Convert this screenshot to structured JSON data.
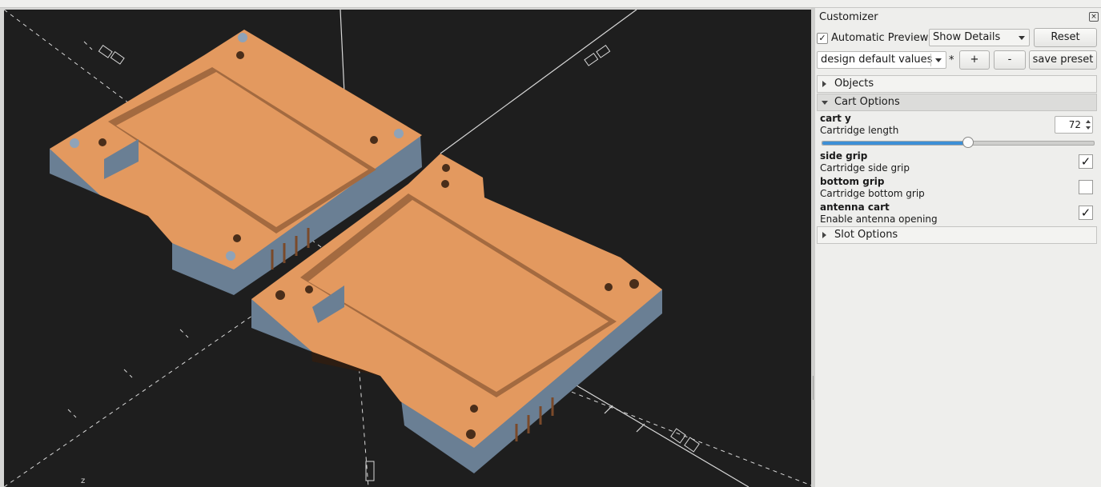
{
  "viewport": {
    "axis_label": "z",
    "colors": {
      "background": "#1e1e1e",
      "part_top": "#e3995f",
      "part_side": "#6a7f94",
      "pocket": "#a36a40",
      "pin": "#8fa3b8"
    }
  },
  "customizer": {
    "title": "Customizer",
    "close_icon": "close-icon",
    "auto_preview_label": "Automatic Preview",
    "auto_preview_checked": true,
    "details_select": "Show Details",
    "reset_label": "Reset",
    "preset_select": "design default values",
    "modified_marker": "*",
    "add_label": "+",
    "remove_label": "-",
    "save_label": "save preset",
    "groups": [
      {
        "label": "Objects",
        "expanded": false
      },
      {
        "label": "Cart Options",
        "expanded": true
      },
      {
        "label": "Slot Options",
        "expanded": false
      }
    ],
    "params": {
      "cart_y": {
        "name": "cart y",
        "desc": "Cartridge length",
        "value": "72",
        "slider_fraction": 0.535
      },
      "side_grip": {
        "name": "side grip",
        "desc": "Cartridge side grip",
        "checked": true
      },
      "bottom_grip": {
        "name": "bottom grip",
        "desc": "Cartridge bottom grip",
        "checked": false
      },
      "antenna_cart": {
        "name": "antenna cart",
        "desc": "Enable antenna opening",
        "checked": true
      }
    }
  }
}
